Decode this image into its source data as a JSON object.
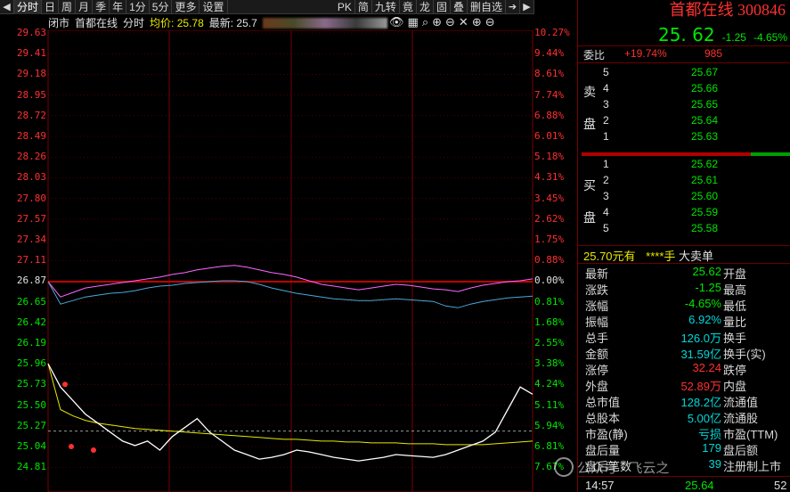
{
  "toolbar": {
    "tabs": [
      "分时",
      "日",
      "周",
      "月",
      "季",
      "年",
      "1分",
      "5分",
      "更多",
      "设置"
    ],
    "right_buttons": [
      "PK",
      "简",
      "九转",
      "竟",
      "龙",
      "固",
      "叠",
      "删自选"
    ]
  },
  "info": {
    "status": "闭市",
    "stock_name": "首都在线",
    "mode": "分时",
    "avg_label": "均价: 25.78",
    "latest_label": "最新: 25.7"
  },
  "chart_data": {
    "type": "line",
    "title": "",
    "prev_close": 26.87,
    "price_ticks": [
      "29.63",
      "29.41",
      "29.18",
      "28.95",
      "28.72",
      "28.49",
      "28.26",
      "28.03",
      "27.80",
      "27.57",
      "27.34",
      "27.11",
      "26.87",
      "26.65",
      "26.42",
      "26.19",
      "25.96",
      "25.73",
      "25.50",
      "25.27",
      "25.04",
      "24.81"
    ],
    "pct_ticks": [
      "10.27%",
      "9.44%",
      "8.61%",
      "7.74%",
      "6.88%",
      "6.01%",
      "5.18%",
      "4.31%",
      "3.45%",
      "2.62%",
      "1.75%",
      "0.88%",
      "0.00%",
      "0.81%",
      "1.68%",
      "2.55%",
      "3.38%",
      "4.24%",
      "5.11%",
      "5.94%",
      "6.81%",
      "7.67%"
    ],
    "index_line": [
      26.87,
      26.7,
      26.75,
      26.8,
      26.82,
      26.84,
      26.86,
      26.88,
      26.9,
      26.92,
      26.95,
      26.97,
      27.0,
      27.02,
      27.04,
      27.05,
      27.03,
      27.0,
      26.97,
      26.95,
      26.92,
      26.88,
      26.84,
      26.82,
      26.8,
      26.78,
      26.8,
      26.82,
      26.84,
      26.83,
      26.81,
      26.79,
      26.78,
      26.76,
      26.8,
      26.83,
      26.85,
      26.87,
      26.88,
      26.9
    ],
    "avg_line": [
      26.87,
      26.62,
      26.66,
      26.7,
      26.72,
      26.74,
      26.75,
      26.77,
      26.8,
      26.82,
      26.83,
      26.85,
      26.86,
      26.87,
      26.88,
      26.88,
      26.87,
      26.84,
      26.8,
      26.77,
      26.74,
      26.72,
      26.7,
      26.68,
      26.67,
      26.66,
      26.66,
      26.67,
      26.68,
      26.67,
      26.66,
      26.65,
      26.6,
      26.58,
      26.62,
      26.65,
      26.67,
      26.69,
      26.7,
      26.71
    ],
    "price_line": [
      25.96,
      25.7,
      25.55,
      25.4,
      25.3,
      25.2,
      25.1,
      25.05,
      25.1,
      25.0,
      25.15,
      25.25,
      25.35,
      25.2,
      25.1,
      25.0,
      24.95,
      24.9,
      24.92,
      24.95,
      25.0,
      24.98,
      24.95,
      24.92,
      24.9,
      24.88,
      24.9,
      24.92,
      24.95,
      24.94,
      24.93,
      24.92,
      24.95,
      25.0,
      25.05,
      25.1,
      25.2,
      25.45,
      25.7,
      25.62
    ],
    "price_avg_line": [
      25.96,
      25.45,
      25.38,
      25.33,
      25.3,
      25.28,
      25.26,
      25.24,
      25.23,
      25.22,
      25.21,
      25.2,
      25.19,
      25.18,
      25.17,
      25.16,
      25.15,
      25.14,
      25.13,
      25.12,
      25.12,
      25.11,
      25.1,
      25.1,
      25.09,
      25.09,
      25.08,
      25.08,
      25.08,
      25.07,
      25.07,
      25.07,
      25.06,
      25.06,
      25.06,
      25.06,
      25.07,
      25.08,
      25.09,
      25.1
    ],
    "ref_line": 25.21
  },
  "colors": {
    "up": "#ff3030",
    "down": "#00e600",
    "grid": "#7a0000",
    "index_line": "#ff66ff",
    "avg_line": "#4aa8d8",
    "price_line": "#ffffff",
    "price_avg_line": "#e8e800"
  },
  "panel": {
    "title": "首都在线 300846",
    "price": "25. 62",
    "change": "-1.25",
    "change_pct": "-4.65%",
    "weibi_label": "委比",
    "weibi_value": "+19.74%",
    "weibi_diff": "985",
    "sell_label_1": "卖",
    "sell_label_2": "盘",
    "buy_label_1": "买",
    "buy_label_2": "盘",
    "sells": [
      {
        "lvl": "5",
        "price": "25.67"
      },
      {
        "lvl": "4",
        "price": "25.66"
      },
      {
        "lvl": "3",
        "price": "25.65"
      },
      {
        "lvl": "2",
        "price": "25.64"
      },
      {
        "lvl": "1",
        "price": "25.63"
      }
    ],
    "buys": [
      {
        "lvl": "1",
        "price": "25.62"
      },
      {
        "lvl": "2",
        "price": "25.61"
      },
      {
        "lvl": "3",
        "price": "25.60"
      },
      {
        "lvl": "4",
        "price": "25.59"
      },
      {
        "lvl": "5",
        "price": "25.58"
      }
    ],
    "big_order_price": "25.70元有",
    "big_order_qty": "****手",
    "big_order_label": "大卖单",
    "stats": [
      {
        "k1": "最新",
        "v1": "25.62",
        "c1": "green",
        "k2": "开盘"
      },
      {
        "k1": "涨跌",
        "v1": "-1.25",
        "c1": "green",
        "k2": "最高"
      },
      {
        "k1": "涨幅",
        "v1": "-4.65%",
        "c1": "green",
        "k2": "最低"
      },
      {
        "k1": "振幅",
        "v1": "6.92%",
        "c1": "cyan",
        "k2": "量比"
      },
      {
        "k1": "总手",
        "v1": "126.0万",
        "c1": "cyan",
        "k2": "换手"
      },
      {
        "k1": "金额",
        "v1": "31.59亿",
        "c1": "cyan",
        "k2": "换手(实)"
      },
      {
        "k1": "涨停",
        "v1": "32.24",
        "c1": "red",
        "k2": "跌停"
      },
      {
        "k1": "外盘",
        "v1": "52.89万",
        "c1": "red",
        "k2": "内盘"
      },
      {
        "k1": "总市值",
        "v1": "128.2亿",
        "c1": "cyan",
        "k2": "流通值"
      },
      {
        "k1": "总股本",
        "v1": "5.00亿",
        "c1": "cyan",
        "k2": "流通股"
      },
      {
        "k1": "市盈(静)",
        "v1": "亏损",
        "c1": "cyan",
        "k2": "市盈(TTM)"
      },
      {
        "k1": "盘后量",
        "v1": "179",
        "c1": "cyan",
        "k2": "盘后额"
      },
      {
        "k1": "盘后笔数",
        "v1": "39",
        "c1": "cyan",
        "k2": "注册制上市"
      }
    ],
    "foot_time": "14:57",
    "foot_price": "25.64",
    "foot_vol": "52"
  },
  "watermark": "公众号 · 飞云之"
}
